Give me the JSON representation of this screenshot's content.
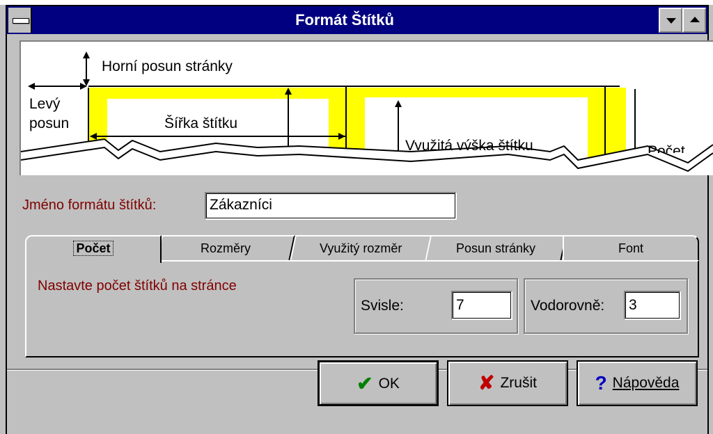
{
  "window": {
    "title": "Formát Štítků",
    "system_menu_icon": "system-menu-icon",
    "minimize_icon": "minimize-icon",
    "maximize_icon": "maximize-icon"
  },
  "preview": {
    "top_offset_label": "Horní posun stránky",
    "left_offset_label_1": "Levý",
    "left_offset_label_2": "posun",
    "label_width_label": "Šířka štítku",
    "used_height_label": "Využitá výška štítku",
    "count_fragment": "Počet"
  },
  "format_name": {
    "label": "Jméno formátu štítků:",
    "value": "Zákazníci"
  },
  "tabs": [
    {
      "label": "Počet",
      "active": true
    },
    {
      "label": "Rozměry",
      "active": false
    },
    {
      "label": "Využitý rozměr",
      "active": false
    },
    {
      "label": "Posun stránky",
      "active": false
    },
    {
      "label": "Font",
      "active": false
    }
  ],
  "count_panel": {
    "instruction": "Nastavte počet štítků na stránce",
    "vertical_label": "Svisle:",
    "vertical_value": "7",
    "horizontal_label": "Vodorovně:",
    "horizontal_value": "3"
  },
  "buttons": {
    "ok_label": "OK",
    "cancel_label": "Zrušit",
    "help_label": "Nápověda",
    "ok_icon": "checkmark-icon",
    "cancel_icon": "x-icon",
    "help_icon": "question-icon"
  },
  "colors": {
    "titlebar": "#000080",
    "label_text": "#800000",
    "label_fill": "#ffff00"
  }
}
